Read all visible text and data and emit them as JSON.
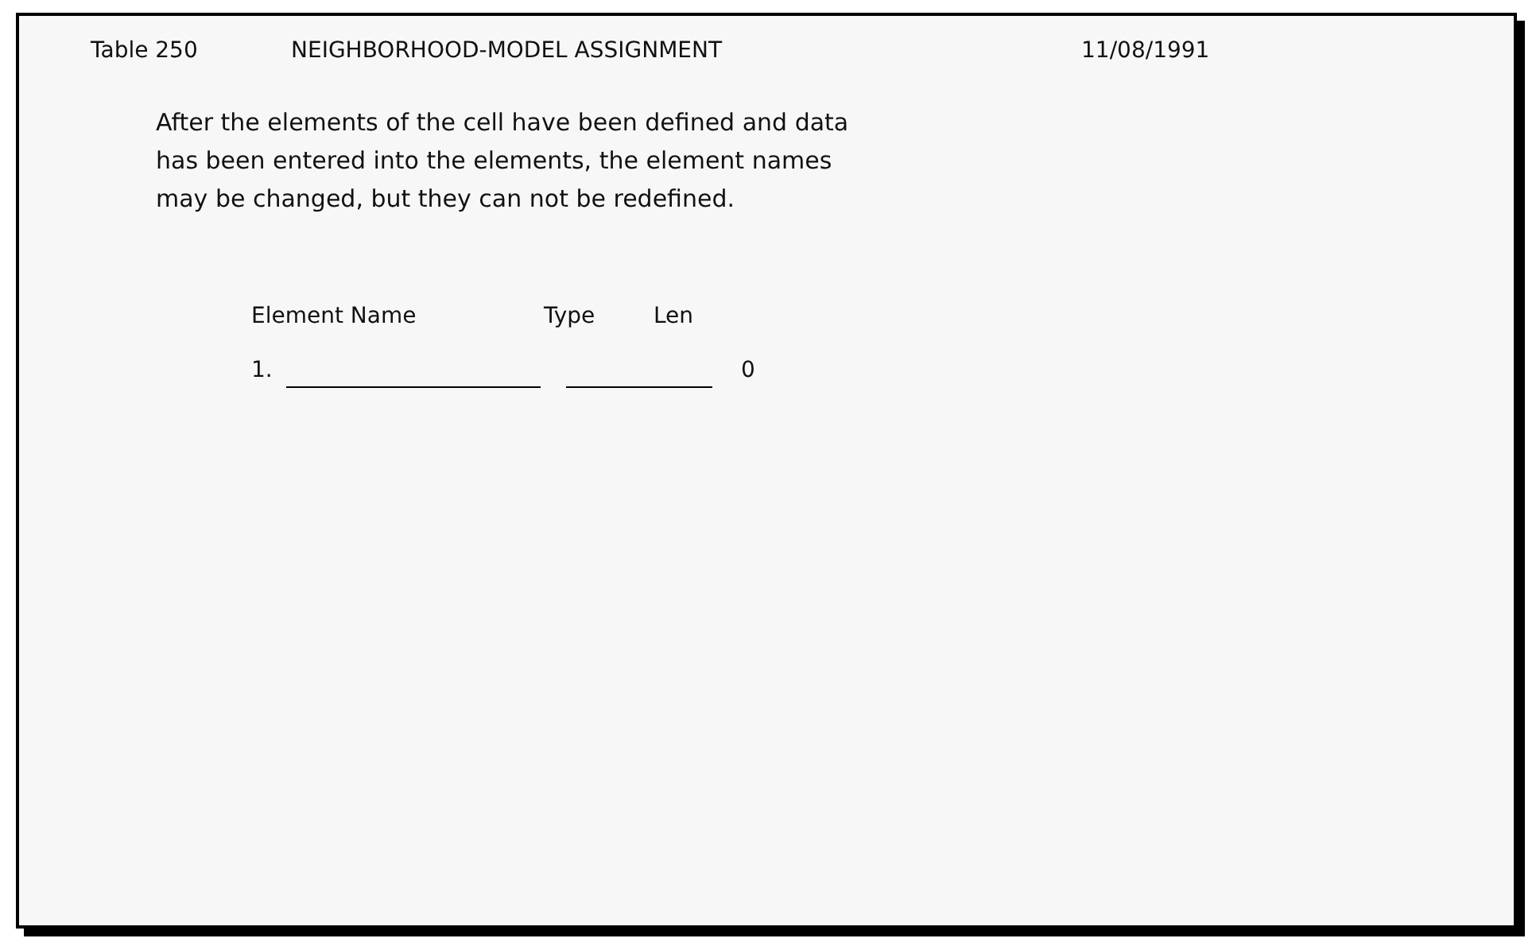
{
  "header": {
    "table": "Table 250",
    "title": "NEIGHBORHOOD-MODEL ASSIGNMENT",
    "date": "11/08/1991"
  },
  "instructions": "After the elements of the cell have been defined and data has been entered into the elements, the element names may be changed, but they can not be redefined.",
  "columns": [
    "Element Name",
    "Type",
    "Len"
  ],
  "rows": [
    {
      "number": "1.",
      "len": "0"
    }
  ]
}
